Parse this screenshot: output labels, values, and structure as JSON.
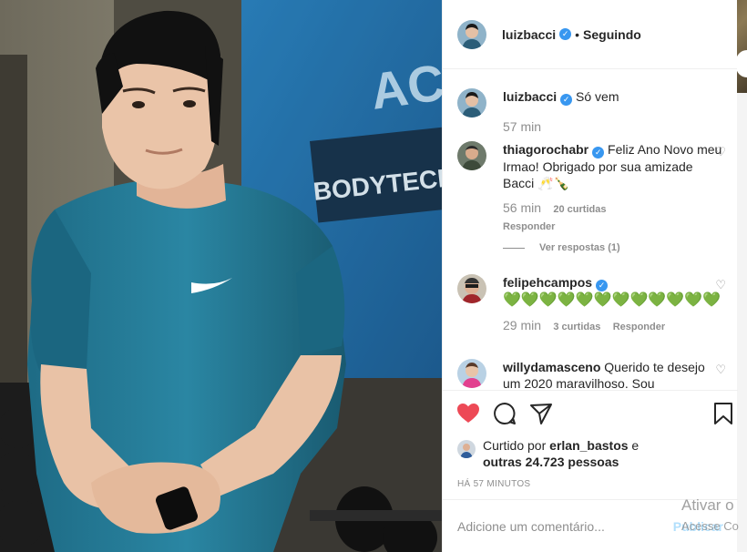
{
  "post": {
    "author": "luizbacci",
    "follow_status": "Seguindo"
  },
  "caption": {
    "author": "luizbacci",
    "text": "Só vem",
    "time": "57 min"
  },
  "comments": [
    {
      "user": "thiagorochabr",
      "text": "Feliz Ano Novo meu Irmao! Obrigado por sua amizade Bacci 🥂🍾",
      "time": "56 min",
      "likes": "20 curtidas",
      "reply_label": "Responder",
      "view_replies": "Ver respostas (1)"
    },
    {
      "user": "felipehcampos",
      "text": "💚💚💚💚💚💚💚💚💚💚💚💚",
      "time": "29 min",
      "likes": "3 curtidas",
      "reply_label": "Responder"
    },
    {
      "user": "willydamasceno",
      "text": "Querido te desejo um 2020 maravilhoso. Sou"
    }
  ],
  "likes": {
    "prefix": "Curtido por",
    "user": "erlan_bastos",
    "connector": "e",
    "others": "outras 24.723 pessoas"
  },
  "timestamp": "HÁ 57 MINUTOS",
  "add_comment": {
    "placeholder": "Adicione um comentário...",
    "publish": "Publicar"
  },
  "watermark": {
    "line1": "Ativar o",
    "line2": "Acesse Co"
  },
  "photo_sign": {
    "line1": "ACES",
    "line2": "BODYTECH.COM"
  },
  "icons": [
    "heart-icon",
    "comment-icon",
    "share-icon",
    "bookmark-icon"
  ],
  "colors": {
    "liked": "#ed4956",
    "verified": "#3897f0",
    "link": "#262626"
  }
}
